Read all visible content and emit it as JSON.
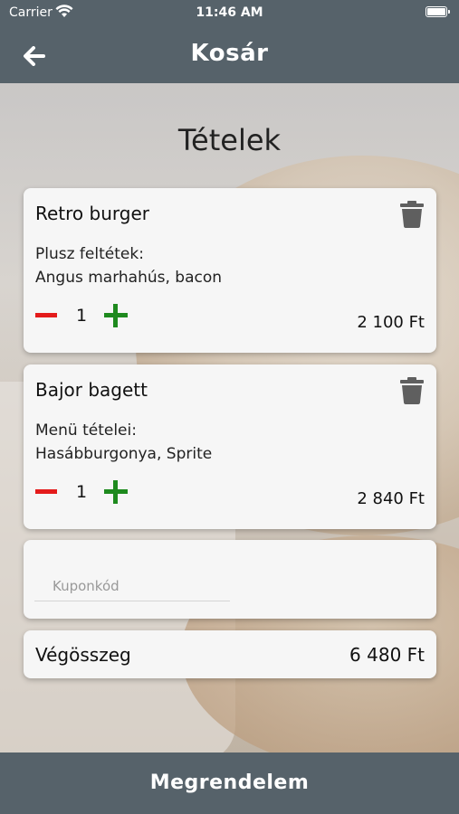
{
  "status_bar": {
    "carrier": "Carrier",
    "time": "11:46 AM"
  },
  "nav": {
    "title": "Kosár",
    "back_icon": "arrow-left-icon"
  },
  "section_title": "Tételek",
  "items": [
    {
      "name": "Retro burger",
      "extras_label": "Plusz feltétek:",
      "extras": "Angus marhahús, bacon",
      "quantity": "1",
      "price": "2 100 Ft"
    },
    {
      "name": "Bajor bagett",
      "extras_label": "Menü tételei:",
      "extras": "Hasábburgonya, Sprite",
      "quantity": "1",
      "price": "2 840 Ft"
    }
  ],
  "coupon": {
    "placeholder": "Kuponkód",
    "value": ""
  },
  "total": {
    "label": "Végösszeg",
    "value": "6 480 Ft"
  },
  "order_button": "Megrendelem",
  "colors": {
    "bar": "#56626a",
    "minus": "#e41b1b",
    "plus": "#1e8a1e",
    "trash": "#5f5f5f"
  }
}
